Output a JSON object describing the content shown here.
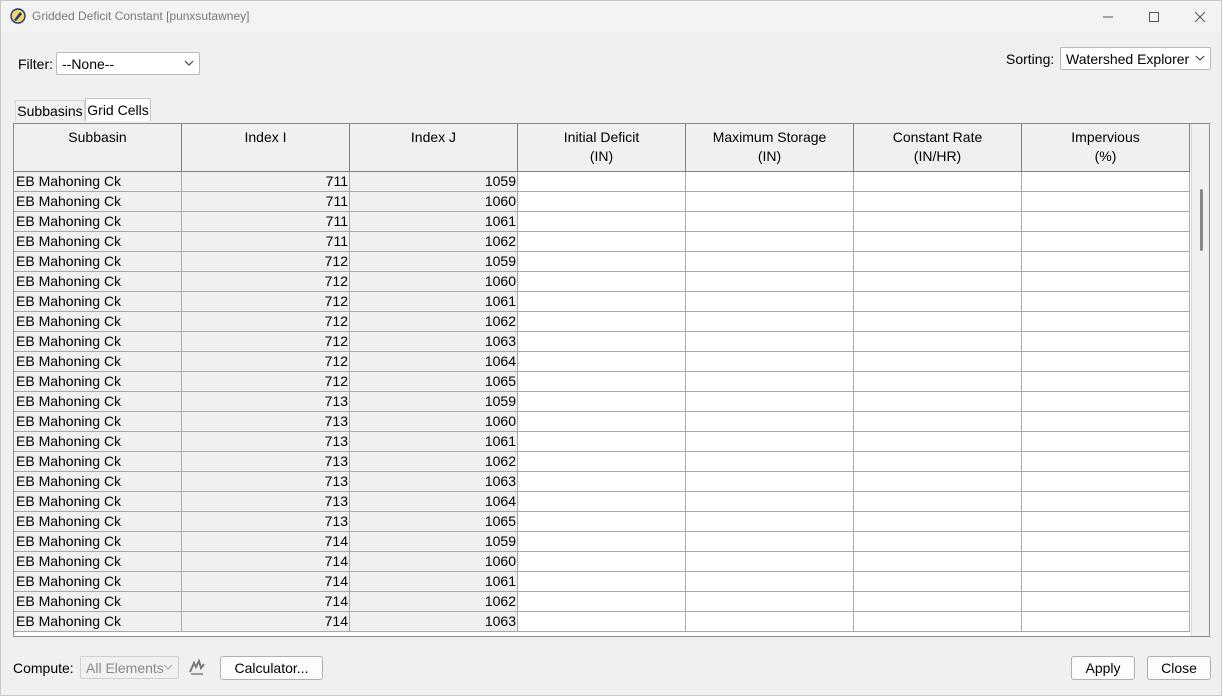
{
  "window": {
    "title": "Gridded Deficit Constant [punxsutawney]",
    "icons": {
      "app": "pen-nib-icon",
      "minimize": "minimize-icon",
      "maximize": "maximize-icon",
      "close": "close-icon"
    }
  },
  "filter": {
    "label": "Filter:",
    "value": "--None--"
  },
  "sorting": {
    "label": "Sorting:",
    "value": "Watershed Explorer"
  },
  "tabs": [
    {
      "label": "Subbasins",
      "active": false
    },
    {
      "label": "Grid Cells",
      "active": true
    }
  ],
  "table": {
    "columns": [
      {
        "line1": "Subbasin",
        "line2": ""
      },
      {
        "line1": "Index I",
        "line2": ""
      },
      {
        "line1": "Index J",
        "line2": ""
      },
      {
        "line1": "Initial Deficit",
        "line2": "(IN)"
      },
      {
        "line1": "Maximum Storage",
        "line2": "(IN)"
      },
      {
        "line1": "Constant Rate",
        "line2": "(IN/HR)"
      },
      {
        "line1": "Impervious",
        "line2": "(%)"
      }
    ],
    "rows": [
      [
        "EB Mahoning Ck",
        "711",
        "1059",
        "",
        "",
        "",
        ""
      ],
      [
        "EB Mahoning Ck",
        "711",
        "1060",
        "",
        "",
        "",
        ""
      ],
      [
        "EB Mahoning Ck",
        "711",
        "1061",
        "",
        "",
        "",
        ""
      ],
      [
        "EB Mahoning Ck",
        "711",
        "1062",
        "",
        "",
        "",
        ""
      ],
      [
        "EB Mahoning Ck",
        "712",
        "1059",
        "",
        "",
        "",
        ""
      ],
      [
        "EB Mahoning Ck",
        "712",
        "1060",
        "",
        "",
        "",
        ""
      ],
      [
        "EB Mahoning Ck",
        "712",
        "1061",
        "",
        "",
        "",
        ""
      ],
      [
        "EB Mahoning Ck",
        "712",
        "1062",
        "",
        "",
        "",
        ""
      ],
      [
        "EB Mahoning Ck",
        "712",
        "1063",
        "",
        "",
        "",
        ""
      ],
      [
        "EB Mahoning Ck",
        "712",
        "1064",
        "",
        "",
        "",
        ""
      ],
      [
        "EB Mahoning Ck",
        "712",
        "1065",
        "",
        "",
        "",
        ""
      ],
      [
        "EB Mahoning Ck",
        "713",
        "1059",
        "",
        "",
        "",
        ""
      ],
      [
        "EB Mahoning Ck",
        "713",
        "1060",
        "",
        "",
        "",
        ""
      ],
      [
        "EB Mahoning Ck",
        "713",
        "1061",
        "",
        "",
        "",
        ""
      ],
      [
        "EB Mahoning Ck",
        "713",
        "1062",
        "",
        "",
        "",
        ""
      ],
      [
        "EB Mahoning Ck",
        "713",
        "1063",
        "",
        "",
        "",
        ""
      ],
      [
        "EB Mahoning Ck",
        "713",
        "1064",
        "",
        "",
        "",
        ""
      ],
      [
        "EB Mahoning Ck",
        "713",
        "1065",
        "",
        "",
        "",
        ""
      ],
      [
        "EB Mahoning Ck",
        "714",
        "1059",
        "",
        "",
        "",
        ""
      ],
      [
        "EB Mahoning Ck",
        "714",
        "1060",
        "",
        "",
        "",
        ""
      ],
      [
        "EB Mahoning Ck",
        "714",
        "1061",
        "",
        "",
        "",
        ""
      ],
      [
        "EB Mahoning Ck",
        "714",
        "1062",
        "",
        "",
        "",
        ""
      ],
      [
        "EB Mahoning Ck",
        "714",
        "1063",
        "",
        "",
        "",
        ""
      ]
    ]
  },
  "footer": {
    "compute_label": "Compute:",
    "compute_value": "All Elements",
    "compute_icon": "compute-run-icon",
    "calculator_label": "Calculator...",
    "apply_label": "Apply",
    "close_label": "Close"
  }
}
